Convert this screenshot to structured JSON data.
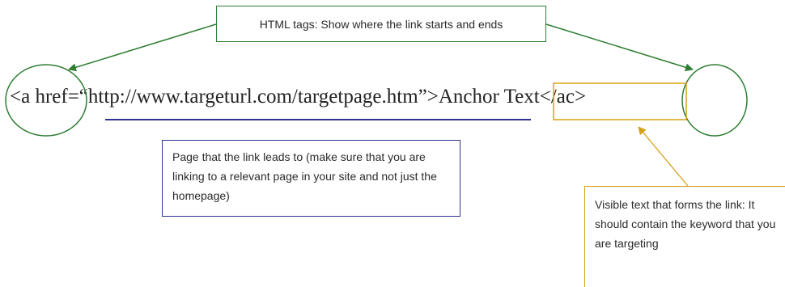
{
  "annotations": {
    "html_tags": "HTML tags: Show where the link starts and ends",
    "target_page": "Page that the link leads to (make sure that you are linking to a relevant page in your site and not just the homepage)",
    "anchor_text": "Visible text that forms the link: It should contain the keyword that you are targeting"
  },
  "code": {
    "open_tag": "<a href=",
    "url": "“http://www.targeturl.com/targetpage.htm”",
    "close_bracket": ">",
    "anchor": "Anchor Text",
    "close_tag": "</ac>"
  },
  "colors": {
    "tags": "#2e7d32",
    "url": "#2e3192",
    "anchor": "#d4a017"
  }
}
